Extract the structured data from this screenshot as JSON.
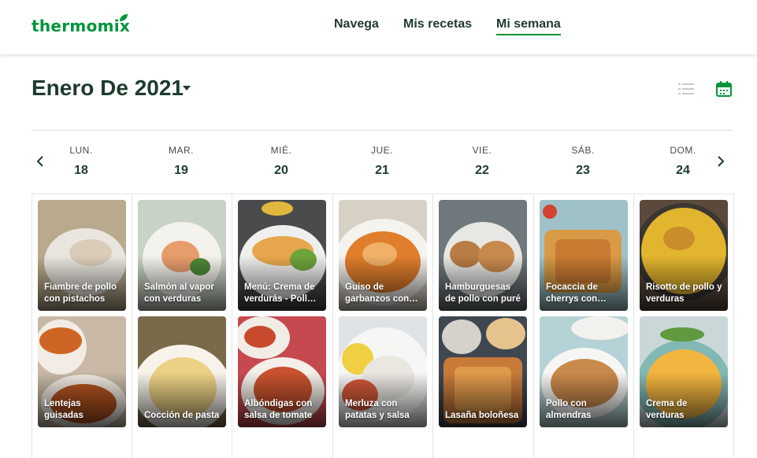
{
  "header": {
    "logo": "thermomix",
    "nav": [
      {
        "label": "Navega",
        "active": false
      },
      {
        "label": "Mis recetas",
        "active": false
      },
      {
        "label": "Mi semana",
        "active": true
      }
    ]
  },
  "calendar": {
    "month_title": "Enero De 2021",
    "view_icons": [
      "list-view-icon",
      "calendar-view-icon"
    ],
    "days": [
      {
        "abbr": "LUN.",
        "num": "18"
      },
      {
        "abbr": "MAR.",
        "num": "19"
      },
      {
        "abbr": "MIÉ.",
        "num": "20"
      },
      {
        "abbr": "JUE.",
        "num": "21"
      },
      {
        "abbr": "VIE.",
        "num": "22"
      },
      {
        "abbr": "SÁB.",
        "num": "23"
      },
      {
        "abbr": "DOM.",
        "num": "24"
      }
    ],
    "recipes": [
      [
        "Fiambre de pollo con pistachos",
        "Lentejas guisadas"
      ],
      [
        "Salmón al vapor con verduras",
        "Cocción de pasta"
      ],
      [
        "Menú: Crema de verdurás - Pollo con verduras",
        "Albóndigas con salsa de tomate"
      ],
      [
        "Guiso de garbanzos con chorizo",
        "Merluza con patatas y salsa"
      ],
      [
        "Hamburguesas de pollo con puré",
        "Lasaña boloñesa"
      ],
      [
        "Focaccia de cherrys con aceitunas",
        "Pollo con almendras"
      ],
      [
        "Risotto de pollo y verduras",
        "Crema de verduras"
      ]
    ]
  },
  "colors": {
    "brand": "#00953a",
    "text": "#1d3b2c"
  }
}
